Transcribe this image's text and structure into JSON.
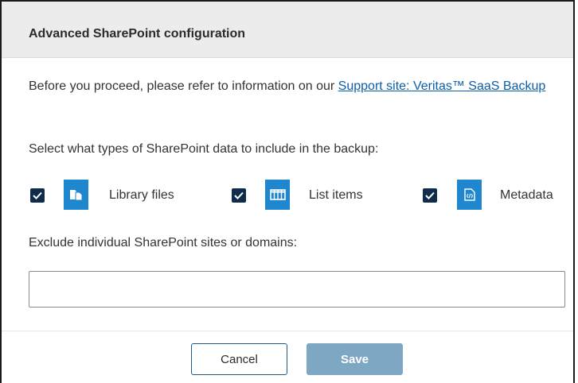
{
  "dialog": {
    "title": "Advanced SharePoint configuration",
    "intro_text": "Before you proceed, please refer to information on our ",
    "support_link": "Support site: Veritas™ SaaS Backup",
    "select_label": "Select what types of SharePoint data to include in the backup:",
    "options": [
      {
        "label": "Library files",
        "checked": true,
        "icon": "library-files-icon"
      },
      {
        "label": "List items",
        "checked": true,
        "icon": "list-items-icon"
      },
      {
        "label": "Metadata",
        "checked": true,
        "icon": "metadata-icon"
      }
    ],
    "exclude_label": "Exclude individual SharePoint sites or domains:",
    "exclude_value": "",
    "cancel_label": "Cancel",
    "save_label": "Save"
  },
  "colors": {
    "checkbox": "#0f2d4a",
    "icon_tile": "#1f86d0",
    "link": "#0b5ea8",
    "save_disabled": "#7ea7c4",
    "header_bg": "#ececec"
  }
}
